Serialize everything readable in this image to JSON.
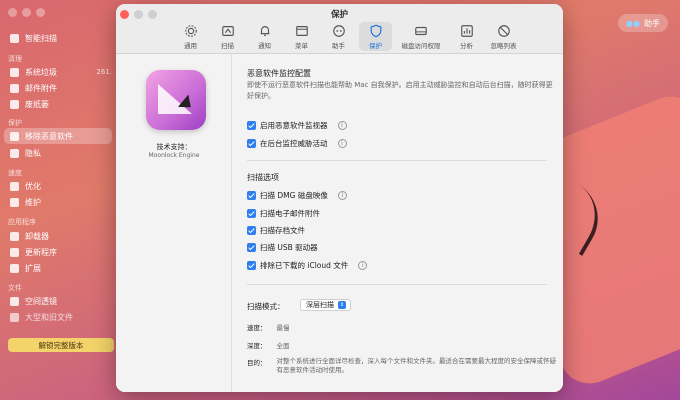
{
  "dialog": {
    "title": "保护",
    "toolbar": [
      {
        "label": "通用",
        "icon": "gear-icon"
      },
      {
        "label": "扫描",
        "icon": "scan-icon"
      },
      {
        "label": "通知",
        "icon": "bell-icon"
      },
      {
        "label": "菜单",
        "icon": "menu-icon"
      },
      {
        "label": "助手",
        "icon": "assistant-icon"
      },
      {
        "label": "保护",
        "icon": "shield-icon"
      },
      {
        "label": "磁盘访问权限",
        "icon": "disk-icon"
      },
      {
        "label": "分析",
        "icon": "chart-icon"
      },
      {
        "label": "忽略列表",
        "icon": "block-icon"
      }
    ],
    "tech_support_label": "技术支持：",
    "tech_support_value": "Moonlock Engine",
    "monitor_section": {
      "title": "恶意软件监控配置",
      "description": "即使不运行恶意软件扫描也能帮助 Mac 自我保护。启用主动威胁监控和自动后台扫描，随时获得更好保护。",
      "options": [
        "启用恶意软件监视器",
        "在后台监控威胁活动"
      ]
    },
    "scan_section": {
      "title": "扫描选项",
      "options": [
        "扫描 DMG 磁盘映像",
        "扫描电子邮件附件",
        "扫描存档文件",
        "扫描 USB 驱动器",
        "排除已下载的 iCloud 文件"
      ]
    },
    "scan_mode": {
      "label": "扫描模式：",
      "value": "深层扫描",
      "speed_label": "速度：",
      "speed_value": "最慢",
      "depth_label": "深度：",
      "depth_value": "全面",
      "goal_label": "目的：",
      "goal_value": "对整个系统进行全面详尽检查，深入每个文件和文件夹。最适合在需要最大程度的安全保障或怀疑有恶意软件活动时使用。"
    }
  },
  "sidebar": {
    "items": [
      {
        "label": "智能扫描",
        "group": ""
      },
      {
        "label": "系统垃圾",
        "group": "清理",
        "extra": "261."
      },
      {
        "label": "邮件附件",
        "group": ""
      },
      {
        "label": "废纸篓",
        "group": ""
      },
      {
        "label": "移除恶意软件",
        "group": "保护"
      },
      {
        "label": "隐私",
        "group": ""
      },
      {
        "label": "优化",
        "group": "速度"
      },
      {
        "label": "维护",
        "group": ""
      },
      {
        "label": "卸载器",
        "group": "应用程序"
      },
      {
        "label": "更新程序",
        "group": ""
      },
      {
        "label": "扩展",
        "group": ""
      },
      {
        "label": "空间透镜",
        "group": "文件"
      },
      {
        "label": "大型和旧文件",
        "group": ""
      }
    ],
    "groups": [
      "清理",
      "保护",
      "速度",
      "应用程序",
      "文件"
    ],
    "unlock_button": "解锁完整版本"
  },
  "help_button": "助手"
}
